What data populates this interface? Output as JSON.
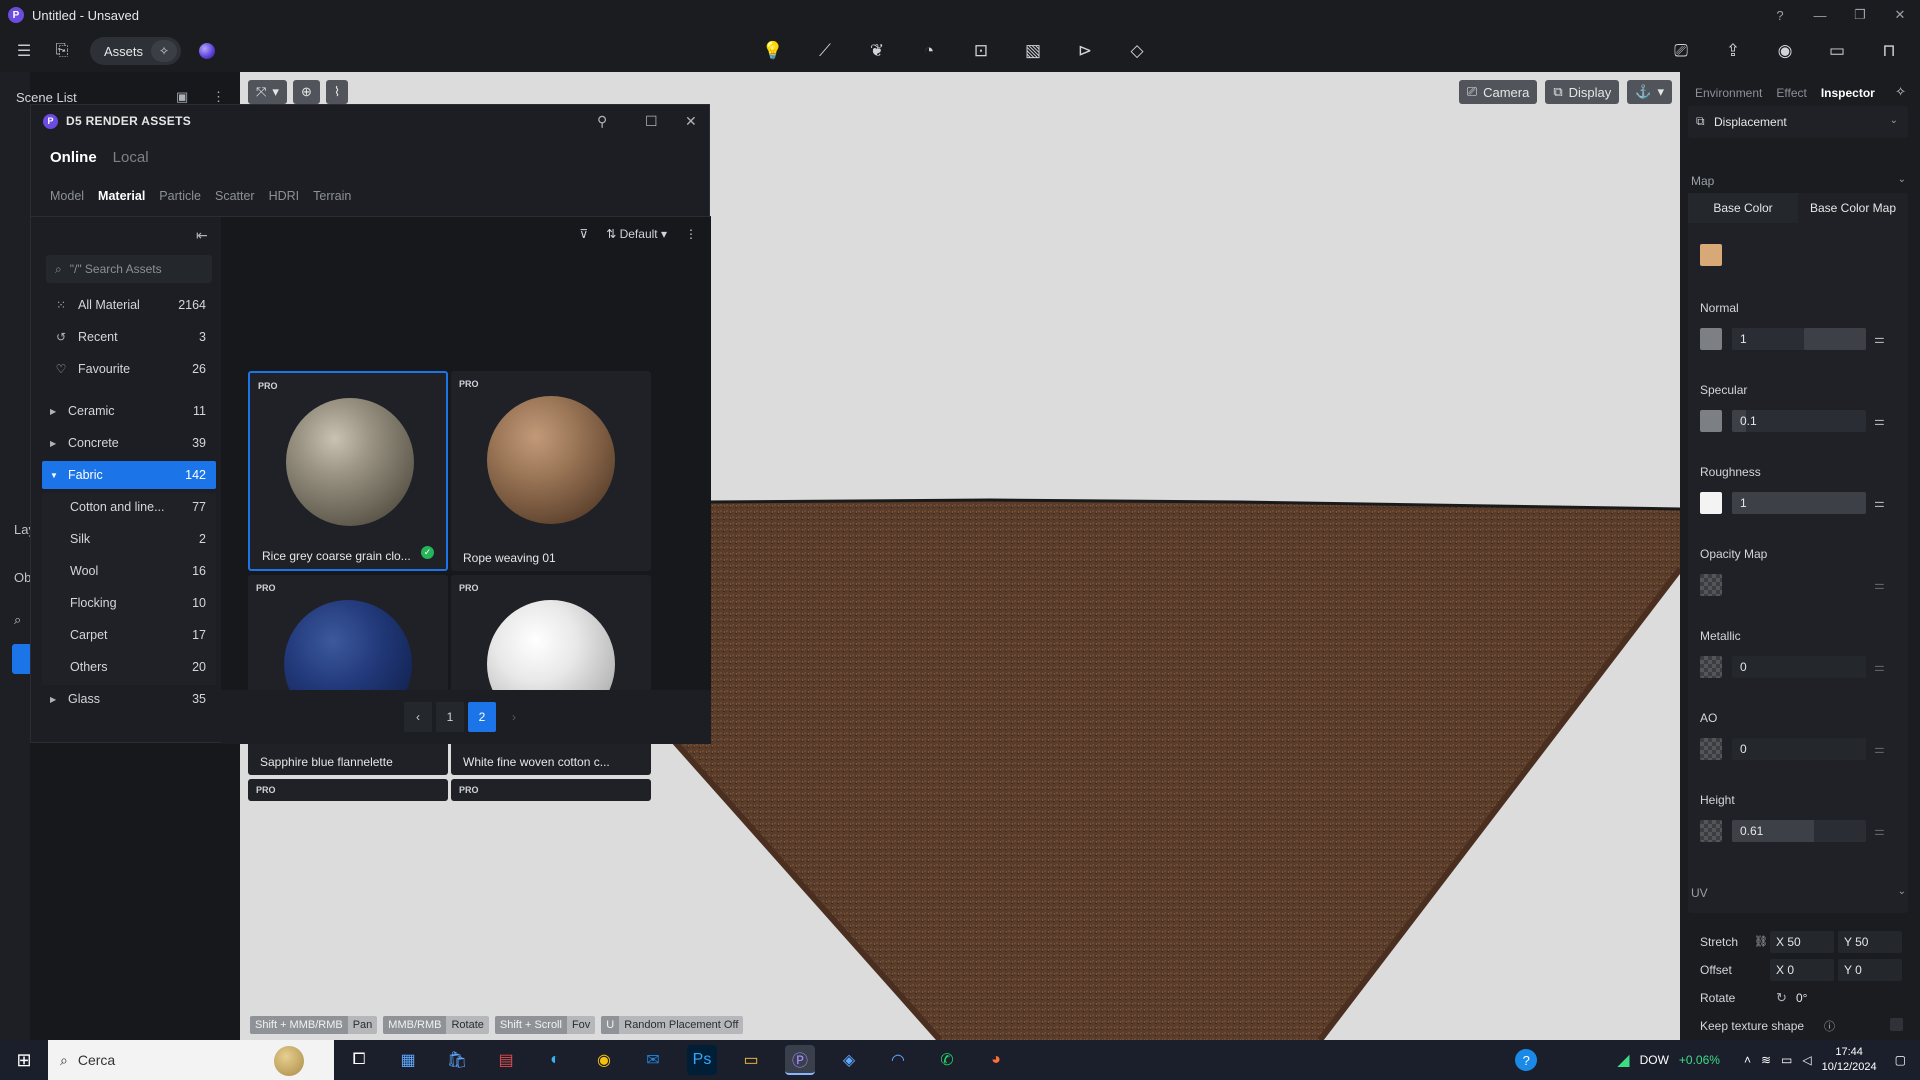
{
  "window": {
    "title": "Untitled - Unsaved",
    "logo": "P"
  },
  "toolbar": {
    "assets_label": "Assets"
  },
  "scene_list": {
    "label": "Scene List"
  },
  "left_frags": {
    "lay": "Lay",
    "obj": "Obj"
  },
  "viewport": {
    "camera_label": "Camera",
    "display_label": "Display",
    "hints": [
      {
        "key": "Shift + MMB/RMB",
        "action": "Pan"
      },
      {
        "key": "MMB/RMB",
        "action": "Rotate"
      },
      {
        "key": "Shift + Scroll",
        "action": "Fov"
      },
      {
        "key": "U",
        "action": "Random Placement Off"
      }
    ]
  },
  "assets_panel": {
    "title": "D5 RENDER ASSETS",
    "tabs": {
      "online": "Online",
      "local": "Local"
    },
    "categories": [
      "Model",
      "Material",
      "Particle",
      "Scatter",
      "HDRI",
      "Terrain"
    ],
    "search_placeholder": "\"/\" Search Assets",
    "sort_label": "Default",
    "sidebar": [
      {
        "label": "All Material",
        "count": "2164",
        "icon": "grid-icon"
      },
      {
        "label": "Recent",
        "count": "3",
        "icon": "history-icon"
      },
      {
        "label": "Favourite",
        "count": "26",
        "icon": "heart-icon"
      },
      {
        "label": "Ceramic",
        "count": "11"
      },
      {
        "label": "Concrete",
        "count": "39"
      },
      {
        "label": "Fabric",
        "count": "142"
      },
      {
        "label": "Cotton and line...",
        "count": "77"
      },
      {
        "label": "Silk",
        "count": "2"
      },
      {
        "label": "Wool",
        "count": "16"
      },
      {
        "label": "Flocking",
        "count": "10"
      },
      {
        "label": "Carpet",
        "count": "17"
      },
      {
        "label": "Others",
        "count": "20"
      },
      {
        "label": "Glass",
        "count": "35"
      }
    ],
    "cards": [
      {
        "badge": "PRO",
        "name": "Rice grey coarse grain clo..."
      },
      {
        "badge": "PRO",
        "name": "Rope weaving 01"
      },
      {
        "badge": "PRO",
        "name": "Sapphire blue flannelette"
      },
      {
        "badge": "PRO",
        "name": "White fine woven cotton c..."
      },
      {
        "badge": "PRO",
        "name": ""
      },
      {
        "badge": "PRO",
        "name": ""
      }
    ],
    "pages": [
      "1",
      "2"
    ]
  },
  "inspector": {
    "tabs": [
      "Environment",
      "Effect",
      "Inspector"
    ],
    "mode": "Displacement",
    "map_section": "Map",
    "base_tabs": [
      "Base Color",
      "Base Color Map"
    ],
    "base_color": "#d8a877",
    "props": [
      {
        "label": "Normal",
        "value": "1"
      },
      {
        "label": "Specular",
        "value": "0.1"
      },
      {
        "label": "Roughness",
        "value": "1"
      },
      {
        "label": "Opacity Map",
        "value": ""
      },
      {
        "label": "Metallic",
        "value": "0"
      },
      {
        "label": "AO",
        "value": "0"
      },
      {
        "label": "Height",
        "value": "0.61"
      }
    ],
    "uv_section": "UV",
    "uv": {
      "stretch_label": "Stretch",
      "stretch_x": "X 50",
      "stretch_y": "Y 50",
      "offset_label": "Offset",
      "offset_x": "X 0",
      "offset_y": "Y 0",
      "rotate_label": "Rotate",
      "rotate_val": "0°",
      "keep_label": "Keep texture shape"
    }
  },
  "taskbar": {
    "search_label": "Cerca",
    "stock_name": "DOW",
    "stock_change": "+0.06%",
    "time": "17:44",
    "date": "10/12/2024"
  },
  "colors": {
    "accent": "#1c75e8",
    "brand": "#6c4ce0",
    "stock_up": "#3ddc84"
  }
}
